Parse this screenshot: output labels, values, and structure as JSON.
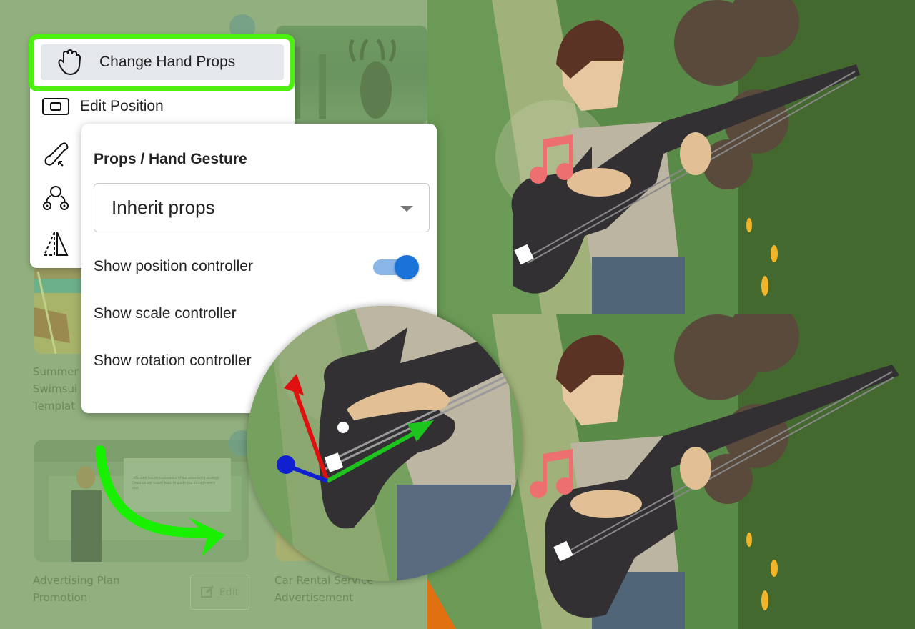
{
  "cards": [
    {
      "title_lines": [
        "Summer",
        "Swimsui",
        "Templat"
      ]
    },
    {
      "title_lines": [
        "Advertising Plan",
        "Promotion"
      ],
      "thumb_text": "Let's step into an exploration of our advertising strategy. Count on our expert team to guide you through every step."
    },
    {
      "title_lines": [
        "Car Rental Service",
        "Advertisement"
      ]
    }
  ],
  "edit_button": {
    "label": "Edit",
    "icon": "edit-icon"
  },
  "context_menu": {
    "items": [
      {
        "label": "Change Hand Props",
        "icon": "hand-icon",
        "highlighted": true
      },
      {
        "label": "Edit Position",
        "icon": "rectangle-position-icon"
      },
      {
        "label": "",
        "icon": "bone-scale-icon"
      },
      {
        "label": "",
        "icon": "rig-joints-icon"
      },
      {
        "label": "",
        "icon": "mirror-flip-icon"
      }
    ]
  },
  "props_panel": {
    "title": "Props / Hand Gesture",
    "select": {
      "value": "Inherit props"
    },
    "options": [
      {
        "label": "Show position controller",
        "toggle": true
      },
      {
        "label": "Show scale controller"
      },
      {
        "label": "Show rotation controller"
      }
    ]
  },
  "colors": {
    "highlight": "#4df011",
    "toggle_on": "#1a73d9",
    "toggle_track": "#8ab6e8",
    "overlay_green": "#92b07f",
    "arrow_green": "#19f000"
  }
}
